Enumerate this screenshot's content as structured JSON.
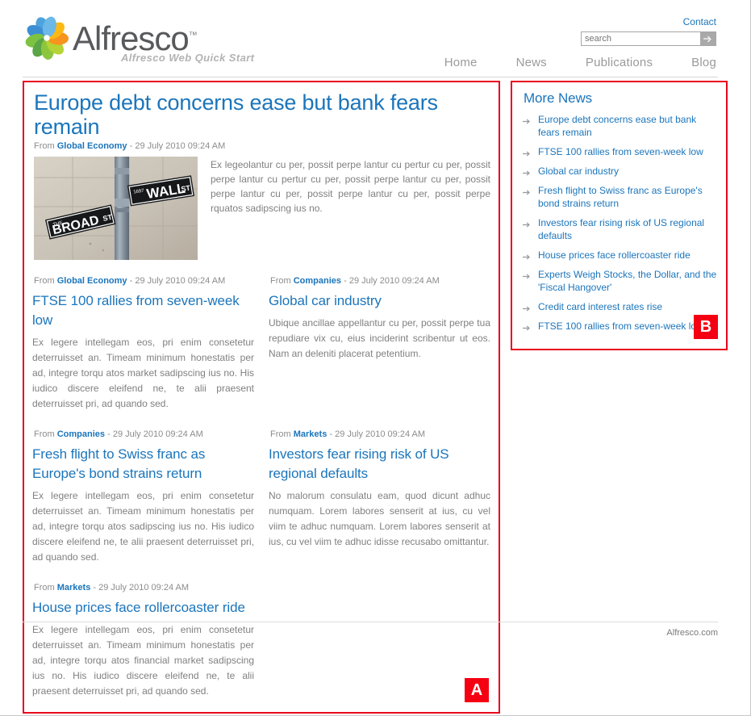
{
  "header": {
    "logo_word": "Alfresco",
    "logo_tm": "™",
    "tagline": "Alfresco Web Quick Start",
    "contact_label": "Contact",
    "search": {
      "value": "",
      "placeholder": "search",
      "button_icon": "arrow-right-icon"
    },
    "nav": [
      {
        "label": "Home"
      },
      {
        "label": "News"
      },
      {
        "label": "Publications"
      },
      {
        "label": "Blog"
      }
    ]
  },
  "markers": {
    "main": "A",
    "sidebar": "B"
  },
  "lead_article": {
    "title": "Europe debt concerns ease but bank fears remain",
    "from_label": "From",
    "section": "Global Economy",
    "separator": "-",
    "date": "29 July 2010 09:24 AM",
    "image_alt": "wall-st-broad-st-street-signs",
    "body": "Ex legeolantur cu per, possit perpe lantur cu pertur cu per, possit perpe lantur cu pertur cu per, possit perpe lantur cu per, possit perpe lantur cu per, possit perpe lantur cu per, possit perpe rquatos sadipscing ius no."
  },
  "articles": [
    {
      "from_label": "From",
      "section": "Global Economy",
      "separator": "-",
      "date": "29 July 2010 09:24 AM",
      "title": "FTSE 100 rallies from seven-week low",
      "body": "Ex legere intellegam eos, pri enim consetetur deterruisset an. Timeam minimum honestatis per ad, integre torqu atos market sadipscing ius no. His iudico discere eleifend ne, te alii praesent deterruisset pri, ad quando sed."
    },
    {
      "from_label": "From",
      "section": "Companies",
      "separator": "-",
      "date": "29 July 2010 09:24 AM",
      "title": "Global car industry",
      "body": "Ubique ancillae appellantur cu per, possit perpe tua repudiare vix cu, eius inciderint scribentur ut eos. Nam an deleniti placerat petentium."
    },
    {
      "from_label": "From",
      "section": "Companies",
      "separator": "-",
      "date": "29 July 2010 09:24 AM",
      "title": "Fresh flight to Swiss franc as Europe's bond strains return",
      "body": "Ex legere intellegam eos, pri enim consetetur deterruisset an. Timeam minimum honestatis per ad, integre torqu atos sadipscing ius no. His iudico discere eleifend ne, te alii praesent deterruisset pri, ad quando sed."
    },
    {
      "from_label": "From",
      "section": "Markets",
      "separator": "-",
      "date": "29 July 2010 09:24 AM",
      "title": "Investors fear rising risk of US regional defaults",
      "body": "No malorum consulatu eam, quod dicunt adhuc numquam. Lorem labores senserit at ius, cu vel viim te adhuc numquam. Lorem labores senserit at ius, cu vel viim te adhuc idisse recusabo omittantur."
    },
    {
      "from_label": "From",
      "section": "Markets",
      "separator": "-",
      "date": "29 July 2010 09:24 AM",
      "title": "House prices face rollercoaster ride",
      "body": "Ex legere intellegam eos, pri enim consetetur deterruisset an. Timeam minimum honestatis per ad, integre torqu atos financial market sadipscing ius no. His iudico discere eleifend ne, te alii praesent deterruisset pri, ad quando sed."
    }
  ],
  "sidebar": {
    "title": "More News",
    "bullet_icon": "arrow-right-icon",
    "items": [
      {
        "label": "Europe debt concerns ease but bank fears remain"
      },
      {
        "label": "FTSE 100 rallies from seven-week low"
      },
      {
        "label": "Global car industry"
      },
      {
        "label": "Fresh flight to Swiss franc as Europe's bond strains return"
      },
      {
        "label": "Investors fear rising risk of US regional defaults"
      },
      {
        "label": "House prices face rollercoaster ride"
      },
      {
        "label": "Experts Weigh Stocks, the Dollar, and the 'Fiscal Hangover'"
      },
      {
        "label": "Credit card interest rates rise"
      },
      {
        "label": "FTSE 100 rallies from seven-week low"
      }
    ]
  },
  "footer": {
    "text": "Alfresco.com"
  },
  "colors": {
    "link_blue": "#1b75bb",
    "body_gray": "#808080",
    "marker_red": "#f50012",
    "annotation_border": "#e8001c"
  }
}
